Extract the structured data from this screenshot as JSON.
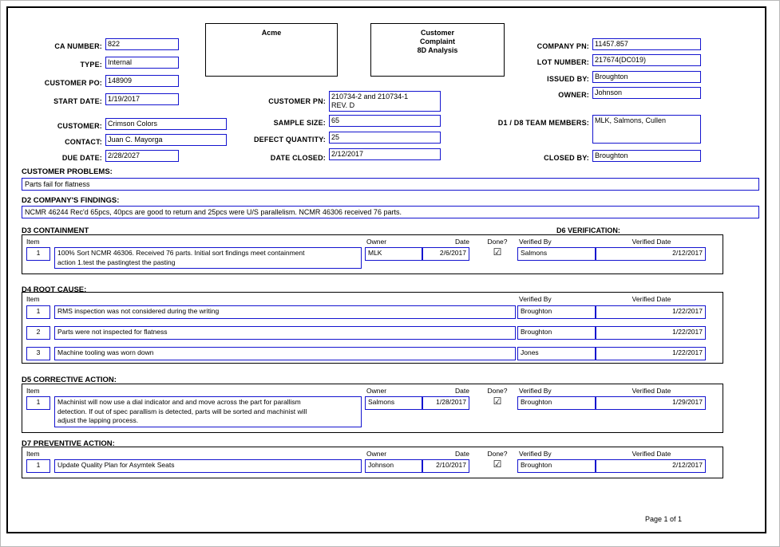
{
  "document": {
    "company_title": "Acme",
    "form_title": "Customer\nComplaint\n8D Analysis",
    "footer": "Page 1 of  1"
  },
  "header_left": {
    "ca_number_label": "CA NUMBER:",
    "ca_number_value": "822",
    "type_label": "TYPE:",
    "type_value": "Internal",
    "customer_po_label": "CUSTOMER PO:",
    "customer_po_value": "148909",
    "start_date_label": "START DATE:",
    "start_date_value": "1/19/2017",
    "customer_label": "CUSTOMER:",
    "customer_value": "Crimson Colors",
    "contact_label": "CONTACT:",
    "contact_value": "Juan C. Mayorga",
    "due_date_label": "DUE DATE:",
    "due_date_value": "2/28/2027"
  },
  "header_center": {
    "customer_pn_label": "CUSTOMER PN:",
    "customer_pn_value": "210734-2  and 210734-1\nREV. D",
    "sample_size_label": "SAMPLE SIZE:",
    "sample_size_value": "65",
    "defect_quantity_label": "DEFECT QUANTITY:",
    "defect_quantity_value": "25",
    "date_closed_label": "DATE CLOSED:",
    "date_closed_value": "2/12/2017"
  },
  "header_right": {
    "company_pn_label": "COMPANY PN:",
    "company_pn_value": "11457.857",
    "lot_number_label": "LOT NUMBER:",
    "lot_number_value": "217674(DC019)",
    "issued_by_label": "ISSUED BY:",
    "issued_by_value": "Broughton",
    "owner_label": "OWNER:",
    "owner_value": "Johnson",
    "team_members_label": "D1 / D8 TEAM MEMBERS:",
    "team_members_value": "MLK, Salmons, Cullen",
    "closed_by_label": "CLOSED BY:",
    "closed_by_value": "Broughton"
  },
  "customer_problems": {
    "heading": "CUSTOMER PROBLEMS:",
    "text": "Parts fail for flatness"
  },
  "company_findings": {
    "heading": "D2 COMPANY'S FINDINGS:",
    "text": "NCMR 46244 Rec'd 65pcs, 40pcs are good to return and 25pcs were U/S parallelism.   NCMR 46306 received 76 parts."
  },
  "d6_verification_heading": "D6  VERIFICATION:",
  "columns": {
    "item": "Item",
    "owner": "Owner",
    "date": "Date",
    "done": "Done?",
    "verified_by": "Verified By",
    "verified_date": "Verified Date"
  },
  "d3_containment": {
    "heading": "D3 CONTAINMENT",
    "rows": [
      {
        "item": "1",
        "description": "100% Sort NCMR 46306. Received 76 parts. Initial sort findings meet containment\naction 1.test the pastingtest the pasting",
        "owner": "MLK",
        "date": "2/6/2017",
        "done": "☑",
        "verified_by": "Salmons",
        "verified_date": "2/12/2017"
      }
    ]
  },
  "d4_root_cause": {
    "heading": "D4  ROOT CAUSE:",
    "rows": [
      {
        "item": "1",
        "description": "RMS inspection was not considered during the writing",
        "verified_by": "Broughton",
        "verified_date": "1/22/2017"
      },
      {
        "item": "2",
        "description": "Parts were not inspected for flatness",
        "verified_by": "Broughton",
        "verified_date": "1/22/2017"
      },
      {
        "item": "3",
        "description": "Machine tooling was worn down",
        "verified_by": "Jones",
        "verified_date": "1/22/2017"
      }
    ]
  },
  "d5_corrective_action": {
    "heading": "D5  CORRECTIVE ACTION:",
    "rows": [
      {
        "item": "1",
        "description": "Machinist will now use a dial indicator and and move across the part for parallism\ndetection. If out of spec parallism is detected, parts will be sorted and machinist will\nadjust the lapping process.",
        "owner": "Salmons",
        "date": "1/28/2017",
        "done": "☑",
        "verified_by": "Broughton",
        "verified_date": "1/29/2017"
      }
    ]
  },
  "d7_preventive_action": {
    "heading": "D7  PREVENTIVE ACTION:",
    "rows": [
      {
        "item": "1",
        "description": "Update Quality Plan for Asymtek Seats",
        "owner": "Johnson",
        "date": "2/10/2017",
        "done": "☑",
        "verified_by": "Broughton",
        "verified_date": "2/12/2017"
      }
    ]
  },
  "colors": {
    "field_border": "#1414cf",
    "frame_border": "#000000",
    "page_bg": "#ffffff"
  }
}
